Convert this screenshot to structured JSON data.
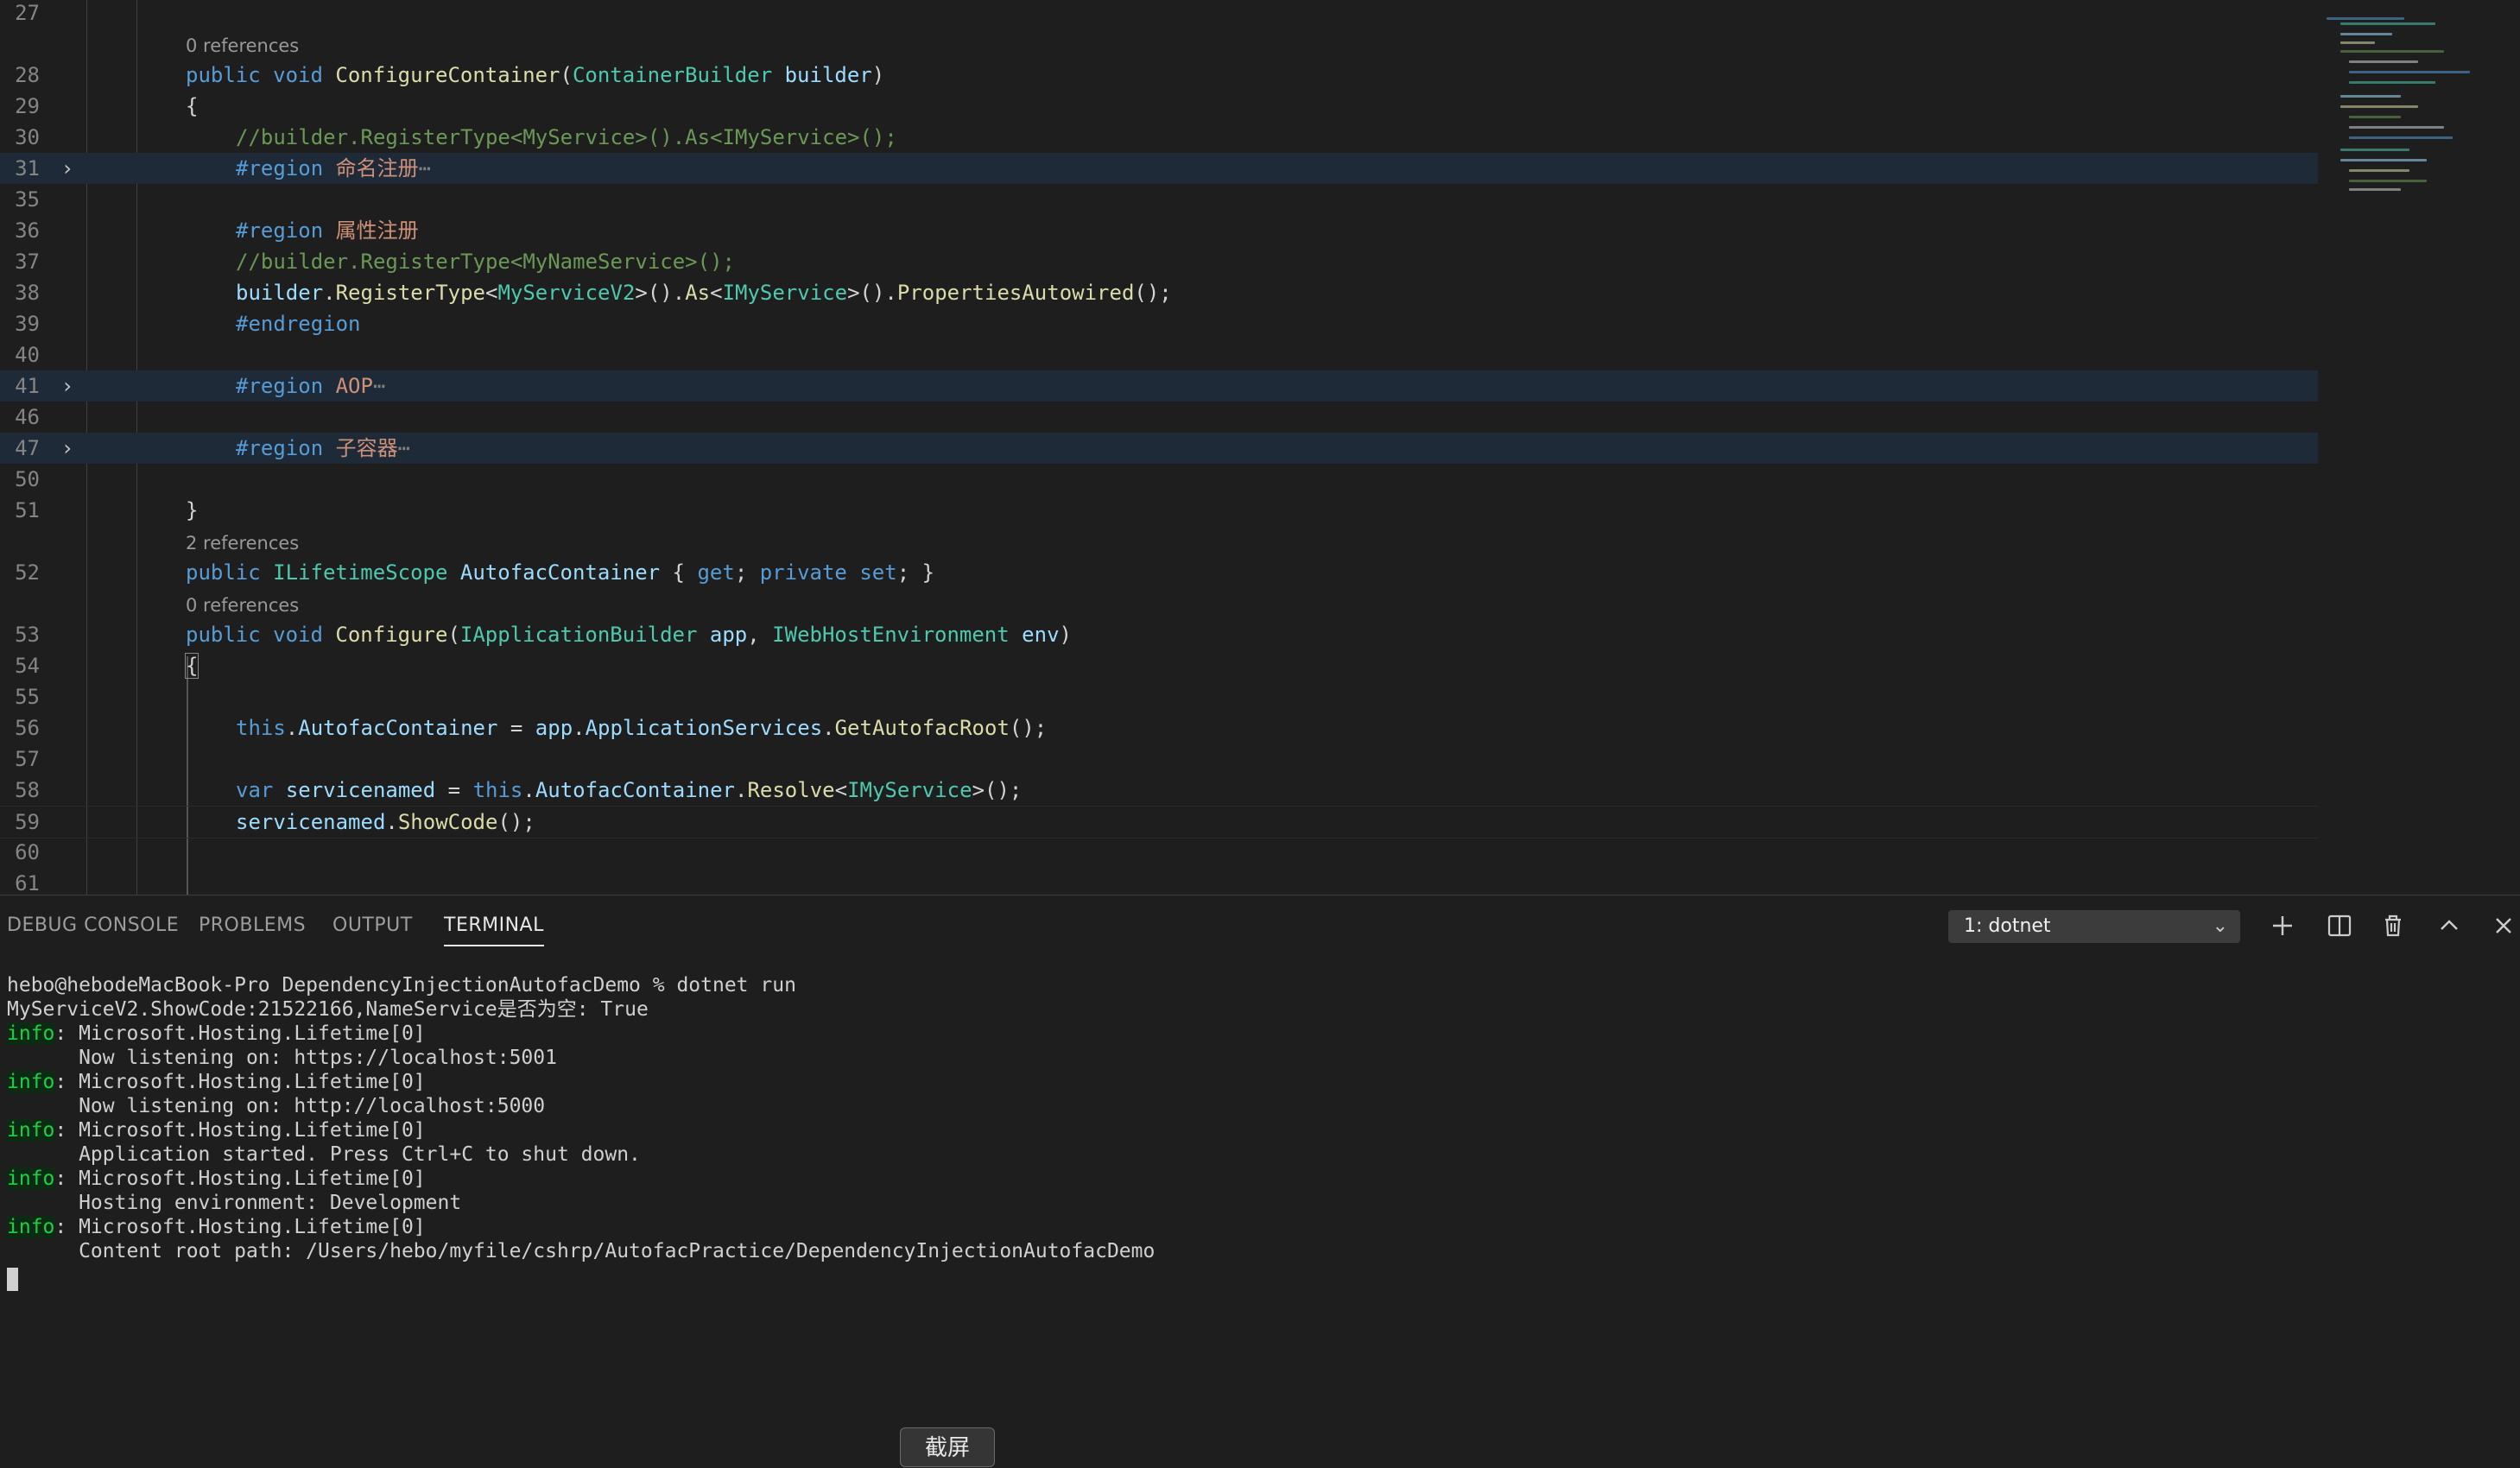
{
  "editor": {
    "lines": [
      {
        "ln": "27"
      },
      {
        "lens": "0 references"
      },
      {
        "ln": "28",
        "tokens": [
          [
            "kw",
            "public"
          ],
          [
            "pl",
            " "
          ],
          [
            "kw",
            "void"
          ],
          [
            "pl",
            " "
          ],
          [
            "fn",
            "ConfigureContainer"
          ],
          [
            "pl",
            "("
          ],
          [
            "ty",
            "ContainerBuilder"
          ],
          [
            "pl",
            " "
          ],
          [
            "vr",
            "builder"
          ],
          [
            "pl",
            ")"
          ]
        ],
        "indent": 1
      },
      {
        "ln": "29",
        "tokens": [
          [
            "pl",
            "{"
          ]
        ],
        "indent": 1
      },
      {
        "ln": "30",
        "tokens": [
          [
            "cm",
            "//builder.RegisterType<MyService>().As<IMyService>();"
          ]
        ],
        "indent": 2
      },
      {
        "ln": "31",
        "fold": true,
        "folded": true,
        "tokens": [
          [
            "kw",
            "#region"
          ],
          [
            "pl",
            " "
          ],
          [
            "rg",
            "命名注册"
          ],
          [
            "ell",
            "⋯"
          ]
        ],
        "indent": 2
      },
      {
        "ln": "35"
      },
      {
        "ln": "36",
        "tokens": [
          [
            "kw",
            "#region"
          ],
          [
            "pl",
            " "
          ],
          [
            "rg",
            "属性注册"
          ]
        ],
        "indent": 2
      },
      {
        "ln": "37",
        "tokens": [
          [
            "cm",
            "//builder.RegisterType<MyNameService>();"
          ]
        ],
        "indent": 2
      },
      {
        "ln": "38",
        "tokens": [
          [
            "vr",
            "builder"
          ],
          [
            "pl",
            "."
          ],
          [
            "fn",
            "RegisterType"
          ],
          [
            "pl",
            "<"
          ],
          [
            "ty",
            "MyServiceV2"
          ],
          [
            "pl",
            ">()."
          ],
          [
            "fn",
            "As"
          ],
          [
            "pl",
            "<"
          ],
          [
            "ty",
            "IMyService"
          ],
          [
            "pl",
            ">()."
          ],
          [
            "fn",
            "PropertiesAutowired"
          ],
          [
            "pl",
            "();"
          ]
        ],
        "indent": 2
      },
      {
        "ln": "39",
        "tokens": [
          [
            "kw",
            "#endregion"
          ]
        ],
        "indent": 2
      },
      {
        "ln": "40"
      },
      {
        "ln": "41",
        "fold": true,
        "folded": true,
        "tokens": [
          [
            "kw",
            "#region"
          ],
          [
            "pl",
            " "
          ],
          [
            "rg",
            "AOP"
          ],
          [
            "ell",
            "⋯"
          ]
        ],
        "indent": 2
      },
      {
        "ln": "46"
      },
      {
        "ln": "47",
        "fold": true,
        "folded": true,
        "tokens": [
          [
            "kw",
            "#region"
          ],
          [
            "pl",
            " "
          ],
          [
            "rg",
            "子容器"
          ],
          [
            "ell",
            "⋯"
          ]
        ],
        "indent": 2
      },
      {
        "ln": "50"
      },
      {
        "ln": "51",
        "tokens": [
          [
            "pl",
            "}"
          ]
        ],
        "indent": 1
      },
      {
        "lens": "2 references"
      },
      {
        "ln": "52",
        "tokens": [
          [
            "kw",
            "public"
          ],
          [
            "pl",
            " "
          ],
          [
            "ty",
            "ILifetimeScope"
          ],
          [
            "pl",
            " "
          ],
          [
            "vr",
            "AutofacContainer"
          ],
          [
            "pl",
            " { "
          ],
          [
            "kw",
            "get"
          ],
          [
            "pl",
            "; "
          ],
          [
            "kw",
            "private"
          ],
          [
            "pl",
            " "
          ],
          [
            "kw",
            "set"
          ],
          [
            "pl",
            "; }"
          ]
        ],
        "indent": 1
      },
      {
        "lens": "0 references"
      },
      {
        "ln": "53",
        "tokens": [
          [
            "kw",
            "public"
          ],
          [
            "pl",
            " "
          ],
          [
            "kw",
            "void"
          ],
          [
            "pl",
            " "
          ],
          [
            "fn",
            "Configure"
          ],
          [
            "pl",
            "("
          ],
          [
            "ty",
            "IApplicationBuilder"
          ],
          [
            "pl",
            " "
          ],
          [
            "vr",
            "app"
          ],
          [
            "pl",
            ", "
          ],
          [
            "ty",
            "IWebHostEnvironment"
          ],
          [
            "pl",
            " "
          ],
          [
            "vr",
            "env"
          ],
          [
            "pl",
            ")"
          ]
        ],
        "indent": 1
      },
      {
        "ln": "54",
        "tokens": [
          [
            "pl",
            "{"
          ]
        ],
        "indent": 1,
        "bracket": true
      },
      {
        "ln": "55"
      },
      {
        "ln": "56",
        "tokens": [
          [
            "kw",
            "this"
          ],
          [
            "pl",
            "."
          ],
          [
            "vr",
            "AutofacContainer"
          ],
          [
            "pl",
            " = "
          ],
          [
            "vr",
            "app"
          ],
          [
            "pl",
            "."
          ],
          [
            "vr",
            "ApplicationServices"
          ],
          [
            "pl",
            "."
          ],
          [
            "fn",
            "GetAutofacRoot"
          ],
          [
            "pl",
            "();"
          ]
        ],
        "indent": 2
      },
      {
        "ln": "57"
      },
      {
        "ln": "58",
        "tokens": [
          [
            "kw",
            "var"
          ],
          [
            "pl",
            " "
          ],
          [
            "vr",
            "servicenamed"
          ],
          [
            "pl",
            " = "
          ],
          [
            "kw",
            "this"
          ],
          [
            "pl",
            "."
          ],
          [
            "vr",
            "AutofacContainer"
          ],
          [
            "pl",
            "."
          ],
          [
            "fn",
            "Resolve"
          ],
          [
            "pl",
            "<"
          ],
          [
            "ty",
            "IMyService"
          ],
          [
            "pl",
            ">();"
          ]
        ],
        "indent": 2
      },
      {
        "ln": "59",
        "tokens": [
          [
            "vr",
            "servicenamed"
          ],
          [
            "pl",
            "."
          ],
          [
            "fn",
            "ShowCode"
          ],
          [
            "pl",
            "();"
          ]
        ],
        "indent": 2,
        "current": true
      },
      {
        "ln": "60"
      },
      {
        "ln": "61"
      }
    ]
  },
  "panel": {
    "tabs": [
      {
        "label": "DEBUG CONSOLE",
        "active": false
      },
      {
        "label": "PROBLEMS",
        "active": false
      },
      {
        "label": "OUTPUT",
        "active": false
      },
      {
        "label": "TERMINAL",
        "active": true
      }
    ],
    "terminal_selector": "1: dotnet",
    "icons": [
      "plus-icon",
      "split-icon",
      "trash-icon",
      "chevron-up-icon",
      "close-icon"
    ]
  },
  "terminal": {
    "lines": [
      {
        "text": "hebo@hebodeMacBook-Pro DependencyInjectionAutofacDemo % dotnet run"
      },
      {
        "text": "MyServiceV2.ShowCode:21522166,NameService是否为空: True"
      },
      {
        "tag": "info",
        "text": ": Microsoft.Hosting.Lifetime[0]"
      },
      {
        "text": "      Now listening on: https://localhost:5001"
      },
      {
        "tag": "info",
        "text": ": Microsoft.Hosting.Lifetime[0]"
      },
      {
        "text": "      Now listening on: http://localhost:5000"
      },
      {
        "tag": "info",
        "text": ": Microsoft.Hosting.Lifetime[0]"
      },
      {
        "text": "      Application started. Press Ctrl+C to shut down."
      },
      {
        "tag": "info",
        "text": ": Microsoft.Hosting.Lifetime[0]"
      },
      {
        "text": "      Hosting environment: Development"
      },
      {
        "tag": "info",
        "text": ": Microsoft.Hosting.Lifetime[0]"
      },
      {
        "text": "      Content root path: /Users/hebo/myfile/cshrp/AutofacPractice/DependencyInjectionAutofacDemo"
      }
    ]
  },
  "overlay": {
    "screenshot_button": "截屏"
  }
}
